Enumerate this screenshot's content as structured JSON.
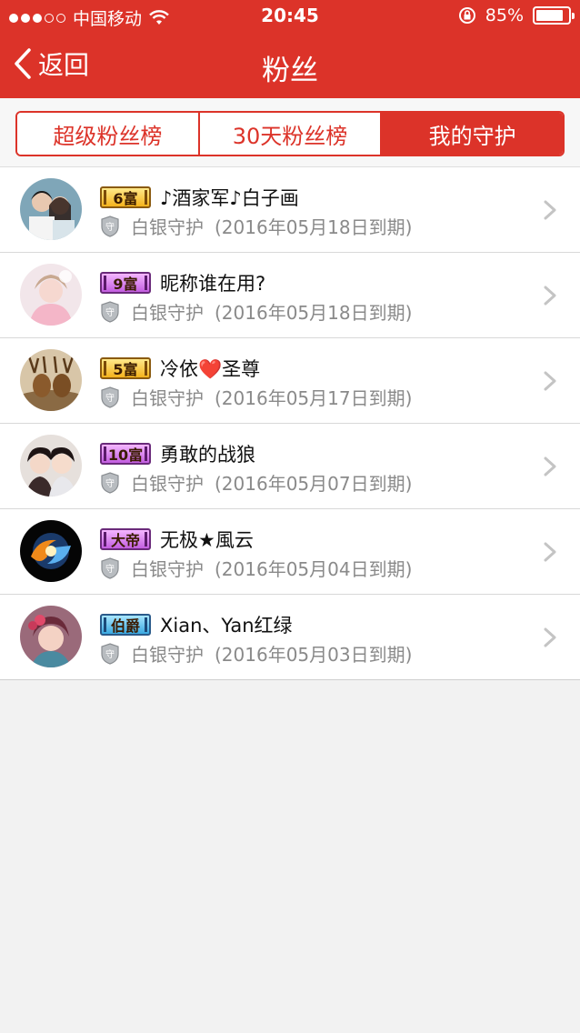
{
  "status_bar": {
    "carrier": "中国移动",
    "time": "20:45",
    "battery": "85%",
    "battery_level": 0.85
  },
  "nav": {
    "back_label": "返回",
    "title": "粉丝"
  },
  "tabs": [
    {
      "label": "超级粉丝榜",
      "active": false
    },
    {
      "label": "30天粉丝榜",
      "active": false
    },
    {
      "label": "我的守护",
      "active": true
    }
  ],
  "fans": [
    {
      "badge": "6富",
      "badge_style": "gold",
      "name": "♪酒家军♪白子画",
      "guard": "白银守护",
      "expiry": "(2016年05月18日到期)"
    },
    {
      "badge": "9富",
      "badge_style": "purple",
      "name": "昵称谁在用?",
      "guard": "白银守护",
      "expiry": "(2016年05月18日到期)"
    },
    {
      "badge": "5富",
      "badge_style": "gold",
      "name": "冷依❤️圣尊",
      "guard": "白银守护",
      "expiry": "(2016年05月17日到期)"
    },
    {
      "badge": "10富",
      "badge_style": "purple",
      "name": "勇敢的战狼",
      "guard": "白银守护",
      "expiry": "(2016年05月07日到期)"
    },
    {
      "badge": "大帝",
      "badge_style": "purple",
      "name": "无极★風云",
      "guard": "白银守护",
      "expiry": "(2016年05月04日到期)"
    },
    {
      "badge": "伯爵",
      "badge_style": "blue",
      "name": "Xian、Yan红绿",
      "guard": "白银守护",
      "expiry": "(2016年05月03日到期)"
    }
  ],
  "icons": {
    "back": "chevron-left-icon",
    "wifi": "wifi-icon",
    "lock": "rotation-lock-icon",
    "battery": "battery-icon",
    "guard": "shield-icon",
    "row_arrow": "chevron-right-icon"
  },
  "colors": {
    "accent": "#dc3329",
    "background": "#f2f2f2"
  }
}
